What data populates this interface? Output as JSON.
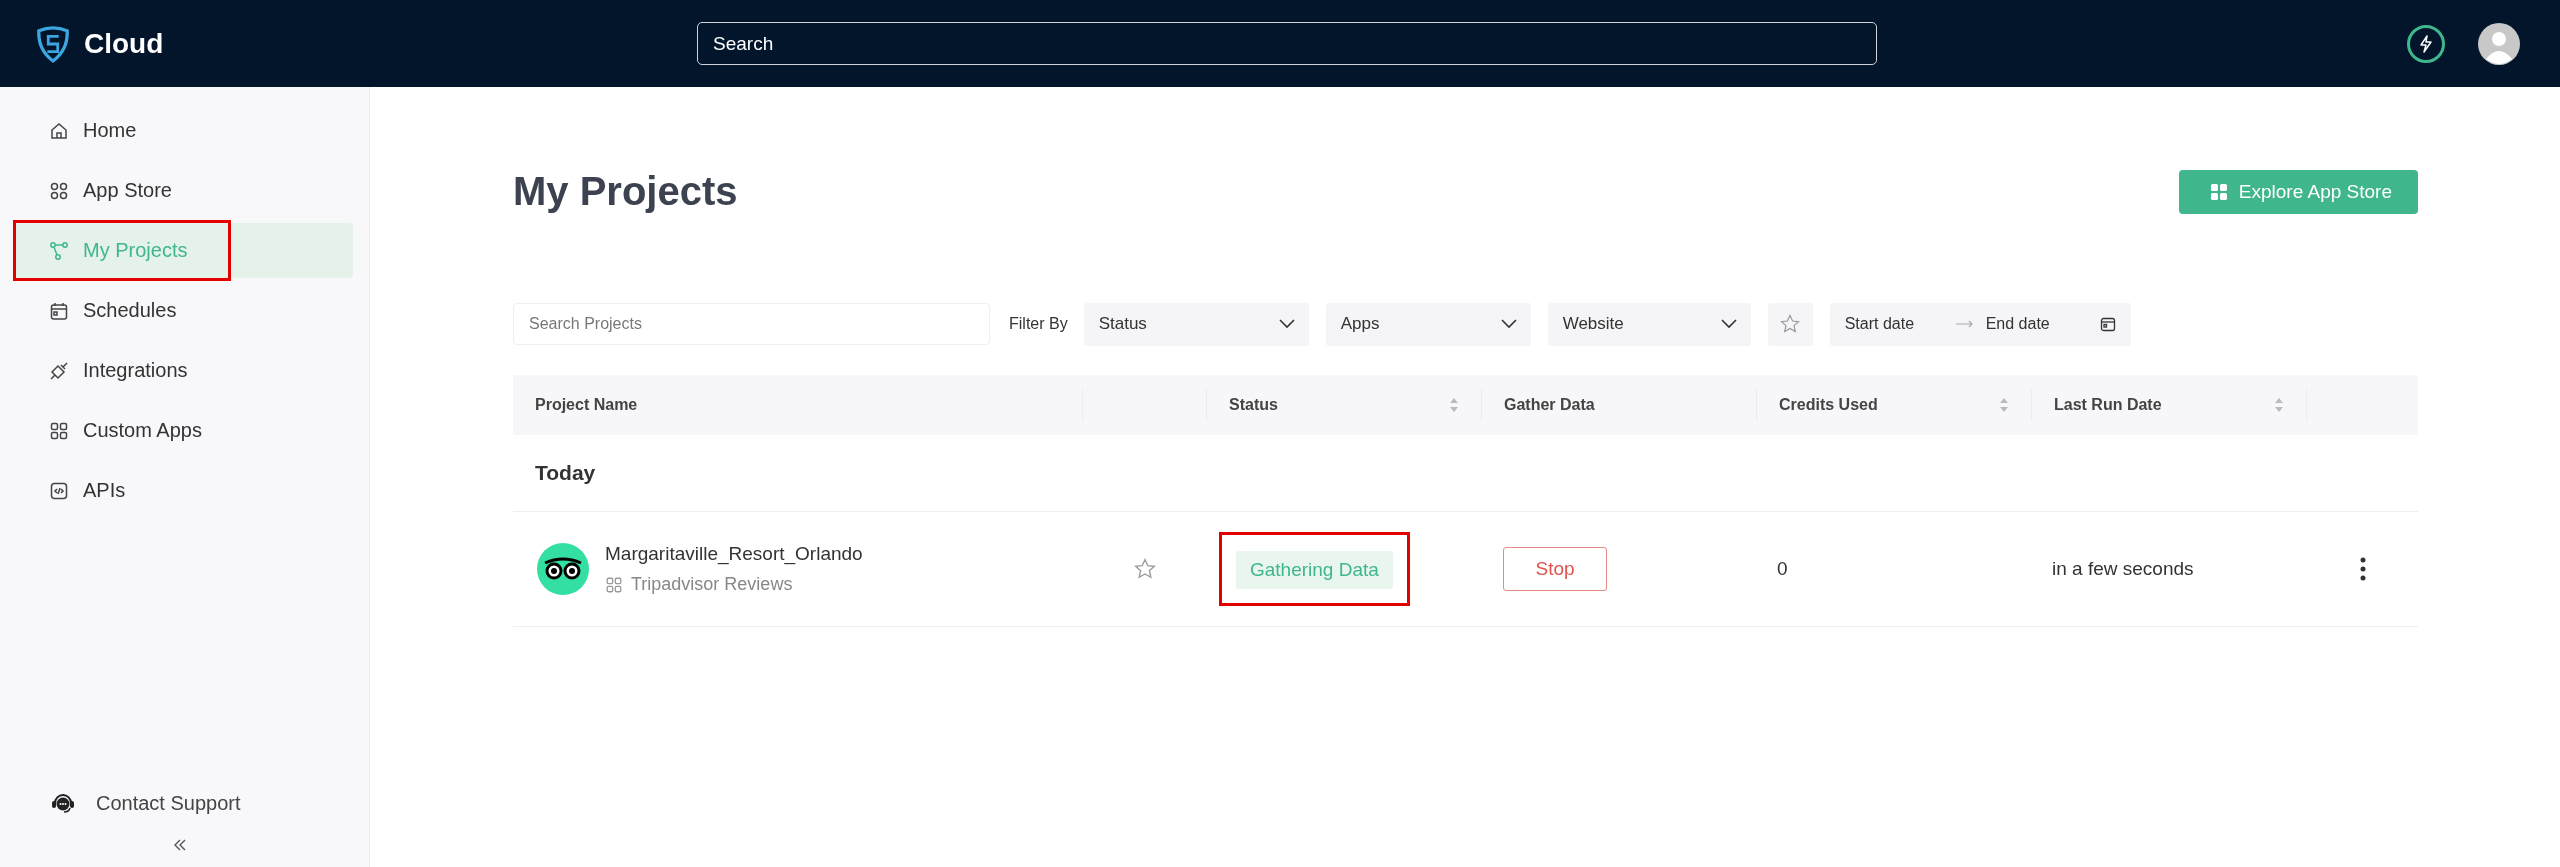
{
  "header": {
    "brand": "Cloud",
    "search": {
      "placeholder": "Search"
    }
  },
  "sidebar": {
    "items": [
      {
        "label": "Home",
        "kind": "home",
        "selected": false,
        "highlighted": false
      },
      {
        "label": "App Store",
        "kind": "grid",
        "selected": false,
        "highlighted": false
      },
      {
        "label": "My Projects",
        "kind": "nodes",
        "selected": true,
        "highlighted": true
      },
      {
        "label": "Schedules",
        "kind": "calendar",
        "selected": false,
        "highlighted": false
      },
      {
        "label": "Integrations",
        "kind": "plug",
        "selected": false,
        "highlighted": false
      },
      {
        "label": "Custom Apps",
        "kind": "apps",
        "selected": false,
        "highlighted": false
      },
      {
        "label": "APIs",
        "kind": "code",
        "selected": false,
        "highlighted": false
      }
    ],
    "contact_support": "Contact Support"
  },
  "page": {
    "title": "My Projects",
    "explore_button": "Explore App Store"
  },
  "filters": {
    "search": {
      "placeholder": "Search Projects"
    },
    "filter_by": "Filter By",
    "selects": [
      {
        "placeholder": "Status"
      },
      {
        "placeholder": "Apps"
      },
      {
        "placeholder": "Website"
      }
    ],
    "favorites_only": false,
    "date_range": {
      "start": "Start date",
      "end": "End date"
    }
  },
  "table": {
    "columns": [
      {
        "label": "Project Name",
        "sortable": false
      },
      {
        "label": "Status",
        "sortable": true
      },
      {
        "label": "Gather Data",
        "sortable": false
      },
      {
        "label": "Credits Used",
        "sortable": true
      },
      {
        "label": "Last Run Date",
        "sortable": true
      }
    ],
    "groups": [
      {
        "title": "Today",
        "rows": [
          {
            "name": "Margaritaville_Resort_Orlando",
            "app": "Tripadvisor Reviews",
            "favorite": false,
            "status": "Gathering Data",
            "status_highlighted": true,
            "action": "Stop",
            "credits": "0",
            "last_run": "in a few seconds"
          }
        ]
      }
    ]
  }
}
